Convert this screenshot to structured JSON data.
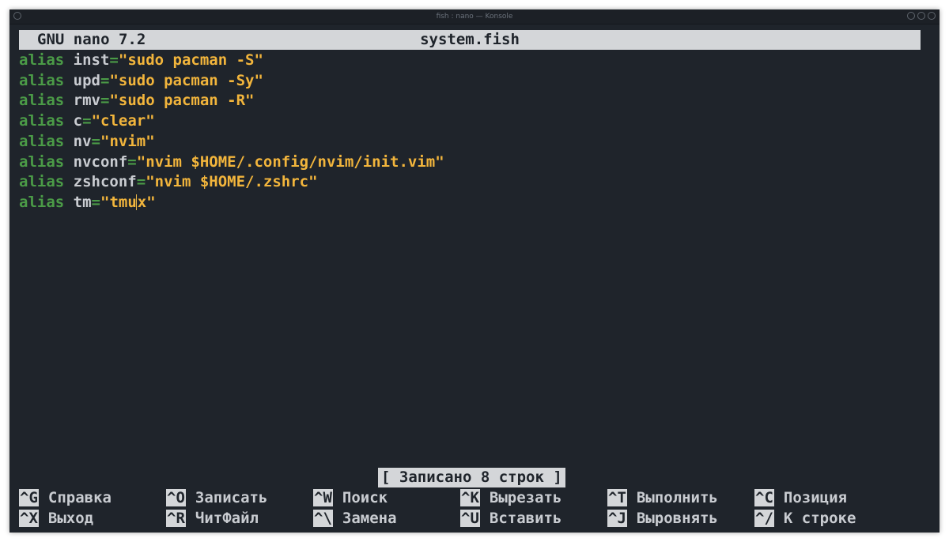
{
  "window": {
    "title": "fish : nano — Konsole"
  },
  "nano": {
    "version": "GNU nano 7.2",
    "filename": "system.fish",
    "status": "[ Записано 8 строк ]"
  },
  "lines": [
    {
      "keyword": "alias",
      "name": "inst",
      "value": "\"sudo pacman -S\""
    },
    {
      "keyword": "alias",
      "name": "upd",
      "value": "\"sudo pacman -Sy\""
    },
    {
      "keyword": "alias",
      "name": "rmv",
      "value": "\"sudo pacman -R\""
    },
    {
      "keyword": "alias",
      "name": "c",
      "value": "\"clear\""
    },
    {
      "keyword": "alias",
      "name": "nv",
      "value": "\"nvim\""
    },
    {
      "keyword": "alias",
      "name": "nvconf",
      "value": "\"nvim $HOME/.config/nvim/init.vim\""
    },
    {
      "keyword": "alias",
      "name": "zshconf",
      "value": "\"nvim $HOME/.zshrc\""
    },
    {
      "keyword": "alias",
      "name": "tm",
      "value_before_cursor": "\"tmu",
      "value_after_cursor": "x\""
    }
  ],
  "shortcuts": [
    [
      {
        "key": "^G",
        "label": "Справка"
      },
      {
        "key": "^O",
        "label": "Записать"
      },
      {
        "key": "^W",
        "label": "Поиск"
      },
      {
        "key": "^K",
        "label": "Вырезать"
      },
      {
        "key": "^T",
        "label": "Выполнить"
      },
      {
        "key": "^C",
        "label": "Позиция"
      }
    ],
    [
      {
        "key": "^X",
        "label": "Выход"
      },
      {
        "key": "^R",
        "label": "ЧитФайл"
      },
      {
        "key": "^\\",
        "label": "Замена"
      },
      {
        "key": "^U",
        "label": "Вставить"
      },
      {
        "key": "^J",
        "label": "Выровнять"
      },
      {
        "key": "^/",
        "label": "К строке"
      }
    ]
  ],
  "colors": {
    "background": "#1f242b",
    "keyword": "#4b9b47",
    "string": "#f2b53c",
    "text": "#c9ccd1",
    "bar": "#d4d6d9"
  }
}
